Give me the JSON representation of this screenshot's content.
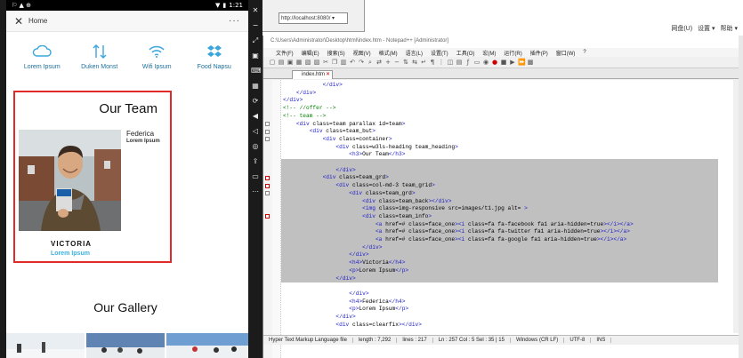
{
  "phone": {
    "status": {
      "left_icons": "⚐ ▲ ⊕",
      "time": "1:21"
    },
    "app_bar": {
      "close_glyph": "✕",
      "title": "Home",
      "more_glyph": "···"
    },
    "features": [
      {
        "icon": "cloud-icon",
        "label": "Lorem Ipsum"
      },
      {
        "icon": "sort-arrows-icon",
        "label": "Duken Monst"
      },
      {
        "icon": "wifi-icon",
        "label": "Wifi Ipsum"
      },
      {
        "icon": "dropbox-icon",
        "label": "Food Napsu"
      }
    ],
    "team": {
      "title": "Our Team",
      "member_name": "Federica",
      "member_role": "Lorem Ipsum",
      "victoria_name": "VICTORIA",
      "victoria_role": "Lorem Ipsum"
    },
    "gallery": {
      "title": "Our Gallery"
    }
  },
  "background": {
    "address_text": "http://localhost:8080/ ▾",
    "links": [
      "网盘(U)",
      "设置 ▾",
      "帮助 ▾"
    ]
  },
  "notepad": {
    "title": "C:\\Users\\Administrator\\Desktop\\html\\index.htm - Notepad++ [Administrator]",
    "menu": [
      "文件(F)",
      "编辑(E)",
      "搜索(S)",
      "视图(V)",
      "格式(M)",
      "语言(L)",
      "设置(T)",
      "工具(O)",
      "宏(M)",
      "运行(R)",
      "插件(P)",
      "窗口(W)",
      "?"
    ],
    "tab_label": "index.htm",
    "code_lines": [
      "            </div>",
      "    </div>",
      "</div>",
      "<!-- //offer -->",
      "<!-- team -->",
      "    <div class=\"team parallax\" id=\"team\">",
      "        <div class=\"team_but\">",
      "            <div class=\"container\">",
      "                <div class=\"w3ls-heading team_heading\">",
      "                    <h3>Our Team</h3>",
      "",
      "                </div>",
      "            <div class=\"team_grd\">",
      "                <div class=\"col-md-3 team_grid\">",
      "                    <div class=\"team_grd\">",
      "                        <div class=\"team_back\"></div>",
      "                        <img class=\"img-responsive\" src=\"images/t1.jpg\" alt=\" \">",
      "                        <div class=\"team_info\">",
      "                            <a href=\"#\" class=\"face_one\"><i class=\"fa fa-facebook fa1\" aria-hidden=\"true\"></i></a>",
      "                            <a href=\"#\" class=\"face_one\"><i class=\"fa fa-twitter fa1\" aria-hidden=\"true\"></i></a>",
      "                            <a href=\"#\" class=\"face_one\"><i class=\"fa fa-google fa1\" aria-hidden=\"true\"></i></a>",
      "                        </div>",
      "                    </div>",
      "                    <h4>Victoria</h4>",
      "                    <p>Lorem Ipsum</p>",
      "                </div>",
      "",
      "                    </div>",
      "                    <h4>Federica</h4>",
      "                    <p>Lorem Ipsum</p>",
      "                </div>",
      "                <div class=\"clearfix\"></div>"
    ],
    "status": {
      "lang": "Hyper Text Markup Language file",
      "length": "length : 7,292",
      "lines": "lines : 217",
      "pos": "Ln : 257   Col : 5   Sel : 35 | 15",
      "eol": "Windows (CR LF)",
      "enc": "UTF-8",
      "mode": "INS"
    }
  }
}
